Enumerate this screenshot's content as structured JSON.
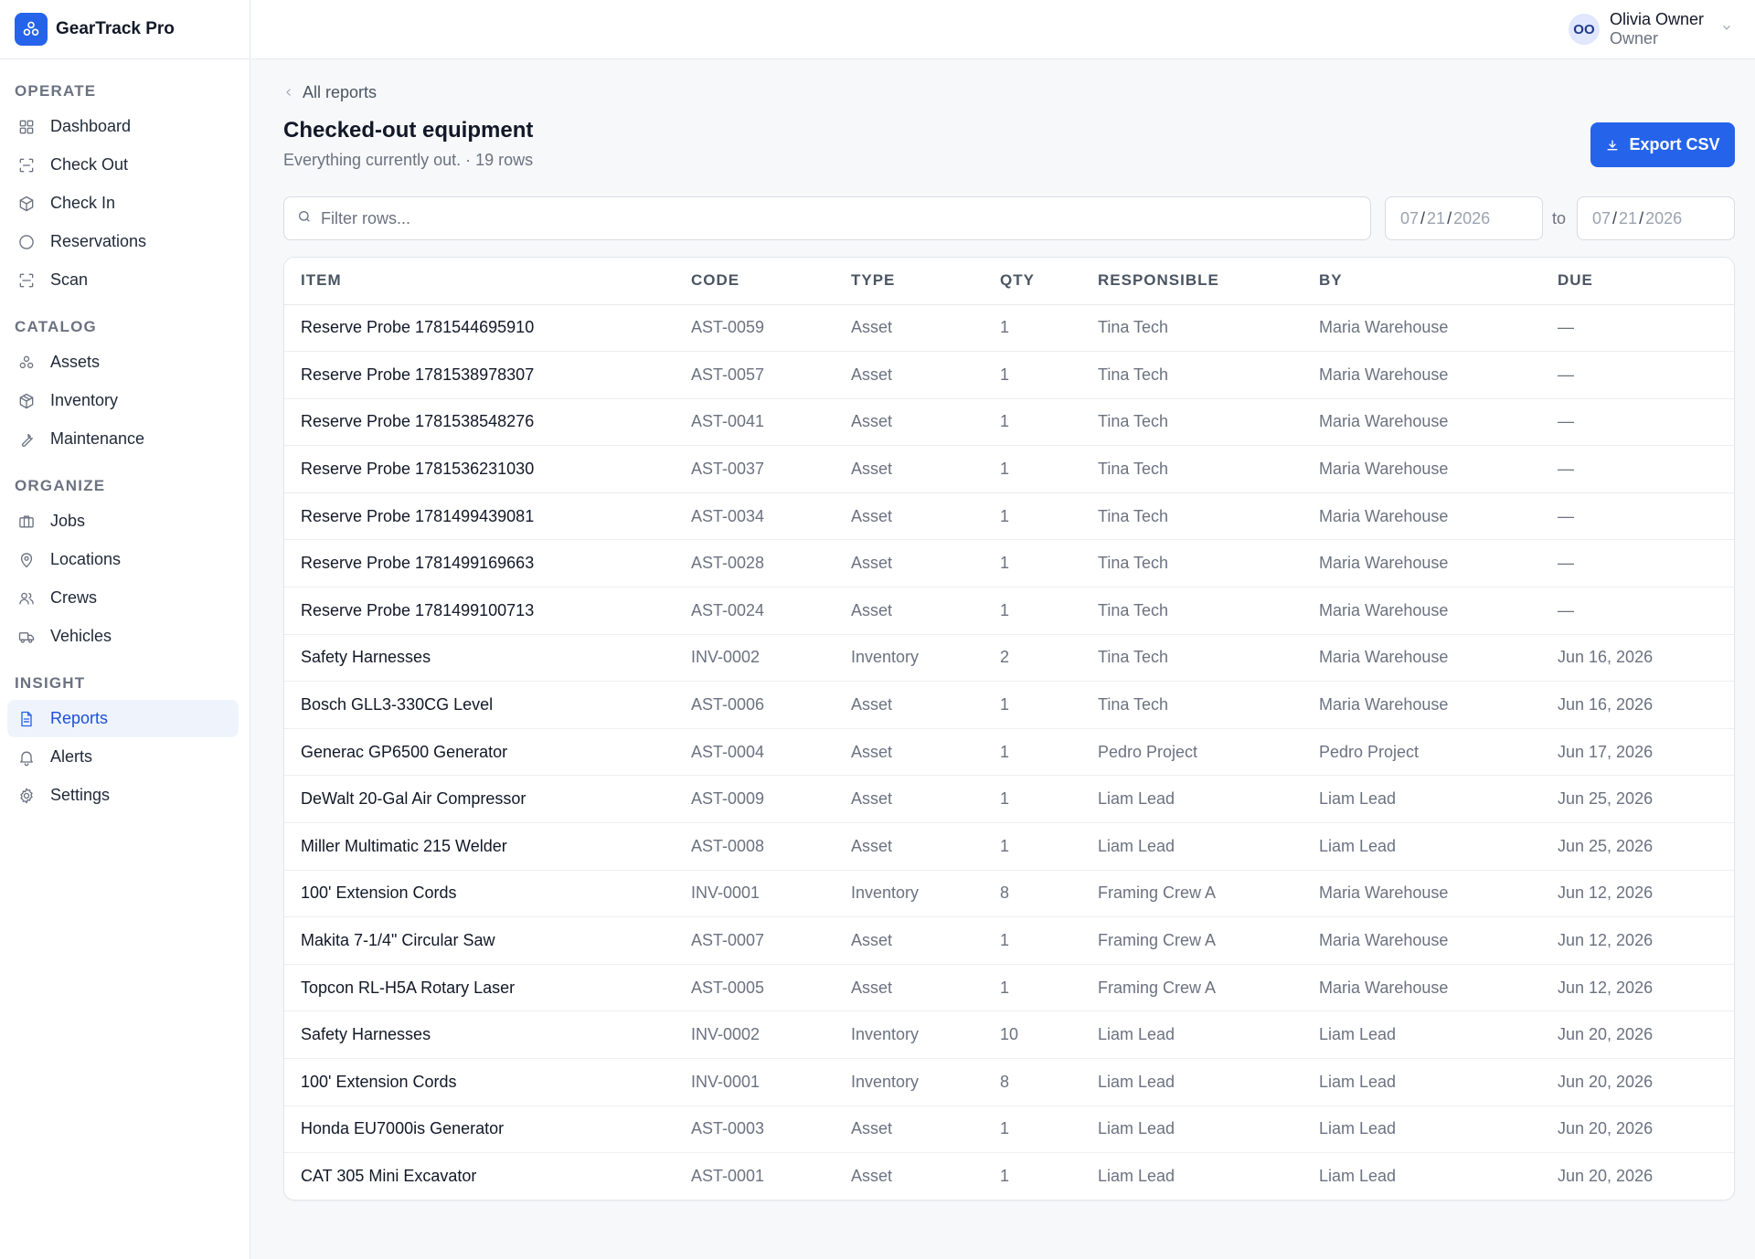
{
  "app": {
    "name": "GearTrack Pro"
  },
  "user": {
    "initials": "OO",
    "name": "Olivia Owner",
    "role": "Owner"
  },
  "sidebar": {
    "sections": [
      {
        "label": "OPERATE",
        "items": [
          {
            "label": "Dashboard",
            "icon": "dashboard-icon"
          },
          {
            "label": "Check Out",
            "icon": "check-out-icon"
          },
          {
            "label": "Check In",
            "icon": "check-in-icon"
          },
          {
            "label": "Reservations",
            "icon": "reservations-icon"
          },
          {
            "label": "Scan",
            "icon": "scan-icon"
          }
        ]
      },
      {
        "label": "CATALOG",
        "items": [
          {
            "label": "Assets",
            "icon": "assets-icon"
          },
          {
            "label": "Inventory",
            "icon": "inventory-icon"
          },
          {
            "label": "Maintenance",
            "icon": "wrench-icon"
          }
        ]
      },
      {
        "label": "ORGANIZE",
        "items": [
          {
            "label": "Jobs",
            "icon": "jobs-icon"
          },
          {
            "label": "Locations",
            "icon": "map-pin-icon"
          },
          {
            "label": "Crews",
            "icon": "users-icon"
          },
          {
            "label": "Vehicles",
            "icon": "truck-icon"
          }
        ]
      },
      {
        "label": "INSIGHT",
        "items": [
          {
            "label": "Reports",
            "icon": "report-icon",
            "active": true
          },
          {
            "label": "Alerts",
            "icon": "bell-icon"
          },
          {
            "label": "Settings",
            "icon": "gear-icon"
          }
        ]
      }
    ]
  },
  "main": {
    "breadcrumb": "All reports",
    "title": "Checked-out equipment",
    "subtitle": "Everything currently out. · 19 rows",
    "export_label": "Export CSV",
    "filter_placeholder": "Filter rows...",
    "date_from": {
      "mm": "07",
      "dd": "21",
      "yyyy": "2026"
    },
    "date_to": {
      "mm": "07",
      "dd": "21",
      "yyyy": "2026"
    },
    "to_label": "to"
  },
  "table": {
    "headers": [
      "ITEM",
      "CODE",
      "TYPE",
      "QTY",
      "RESPONSIBLE",
      "BY",
      "DUE"
    ],
    "rows": [
      [
        "Reserve Probe 1781544695910",
        "AST-0059",
        "Asset",
        "1",
        "Tina Tech",
        "Maria Warehouse",
        "—"
      ],
      [
        "Reserve Probe 1781538978307",
        "AST-0057",
        "Asset",
        "1",
        "Tina Tech",
        "Maria Warehouse",
        "—"
      ],
      [
        "Reserve Probe 1781538548276",
        "AST-0041",
        "Asset",
        "1",
        "Tina Tech",
        "Maria Warehouse",
        "—"
      ],
      [
        "Reserve Probe 1781536231030",
        "AST-0037",
        "Asset",
        "1",
        "Tina Tech",
        "Maria Warehouse",
        "—"
      ],
      [
        "Reserve Probe 1781499439081",
        "AST-0034",
        "Asset",
        "1",
        "Tina Tech",
        "Maria Warehouse",
        "—"
      ],
      [
        "Reserve Probe 1781499169663",
        "AST-0028",
        "Asset",
        "1",
        "Tina Tech",
        "Maria Warehouse",
        "—"
      ],
      [
        "Reserve Probe 1781499100713",
        "AST-0024",
        "Asset",
        "1",
        "Tina Tech",
        "Maria Warehouse",
        "—"
      ],
      [
        "Safety Harnesses",
        "INV-0002",
        "Inventory",
        "2",
        "Tina Tech",
        "Maria Warehouse",
        "Jun 16, 2026"
      ],
      [
        "Bosch GLL3-330CG Level",
        "AST-0006",
        "Asset",
        "1",
        "Tina Tech",
        "Maria Warehouse",
        "Jun 16, 2026"
      ],
      [
        "Generac GP6500 Generator",
        "AST-0004",
        "Asset",
        "1",
        "Pedro Project",
        "Pedro Project",
        "Jun 17, 2026"
      ],
      [
        "DeWalt 20-Gal Air Compressor",
        "AST-0009",
        "Asset",
        "1",
        "Liam Lead",
        "Liam Lead",
        "Jun 25, 2026"
      ],
      [
        "Miller Multimatic 215 Welder",
        "AST-0008",
        "Asset",
        "1",
        "Liam Lead",
        "Liam Lead",
        "Jun 25, 2026"
      ],
      [
        "100' Extension Cords",
        "INV-0001",
        "Inventory",
        "8",
        "Framing Crew A",
        "Maria Warehouse",
        "Jun 12, 2026"
      ],
      [
        "Makita 7-1/4\" Circular Saw",
        "AST-0007",
        "Asset",
        "1",
        "Framing Crew A",
        "Maria Warehouse",
        "Jun 12, 2026"
      ],
      [
        "Topcon RL-H5A Rotary Laser",
        "AST-0005",
        "Asset",
        "1",
        "Framing Crew A",
        "Maria Warehouse",
        "Jun 12, 2026"
      ],
      [
        "Safety Harnesses",
        "INV-0002",
        "Inventory",
        "10",
        "Liam Lead",
        "Liam Lead",
        "Jun 20, 2026"
      ],
      [
        "100' Extension Cords",
        "INV-0001",
        "Inventory",
        "8",
        "Liam Lead",
        "Liam Lead",
        "Jun 20, 2026"
      ],
      [
        "Honda EU7000is Generator",
        "AST-0003",
        "Asset",
        "1",
        "Liam Lead",
        "Liam Lead",
        "Jun 20, 2026"
      ],
      [
        "CAT 305 Mini Excavator",
        "AST-0001",
        "Asset",
        "1",
        "Liam Lead",
        "Liam Lead",
        "Jun 20, 2026"
      ]
    ]
  },
  "colors": {
    "accent": "#2563eb",
    "active_bg": "#eff4fc",
    "border": "#e6e8ec"
  }
}
